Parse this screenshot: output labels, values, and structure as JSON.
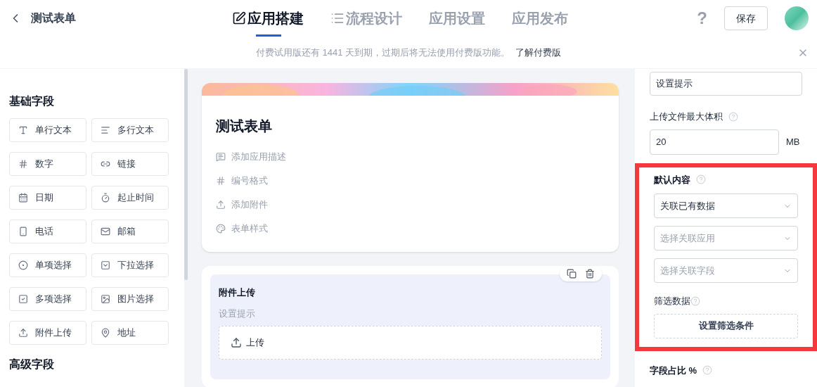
{
  "header": {
    "title": "测试表单",
    "tabs": [
      {
        "label": "应用搭建",
        "selected": true
      },
      {
        "label": "流程设计",
        "selected": false
      },
      {
        "label": "应用设置",
        "selected": false
      },
      {
        "label": "应用发布",
        "selected": false
      }
    ],
    "help": "?",
    "save": "保存"
  },
  "notice": {
    "text": "付费试用版还有 1441 天到期，过期后将无法使用付费版功能。",
    "link": "了解付费版"
  },
  "palette": {
    "sections": [
      {
        "title": "基础字段",
        "items": [
          "单行文本",
          "多行文本",
          "数字",
          "链接",
          "日期",
          "起止时间",
          "电话",
          "邮箱",
          "单项选择",
          "下拉选择",
          "多项选择",
          "图片选择",
          "附件上传",
          "地址"
        ]
      },
      {
        "title": "高级字段"
      }
    ]
  },
  "form": {
    "title": "测试表单",
    "actions": [
      "添加应用描述",
      "编号格式",
      "添加附件",
      "表单样式"
    ],
    "field": {
      "label": "附件上传",
      "hint": "设置提示",
      "upload": "上传",
      "selected": true
    }
  },
  "settings": {
    "hint_field": {
      "value": "设置提示"
    },
    "max_size_label": "上传文件最大体积",
    "max_size": "20",
    "unit": "MB",
    "default_label": "默认内容",
    "selects": [
      {
        "value": "关联已有数据"
      },
      {
        "placeholder": "选择关联应用"
      },
      {
        "placeholder": "选择关联字段"
      }
    ],
    "filter_label": "筛选数据",
    "filter_button": "设置筛选条件",
    "ratio_label": "字段占比 %",
    "highlighted": true
  }
}
